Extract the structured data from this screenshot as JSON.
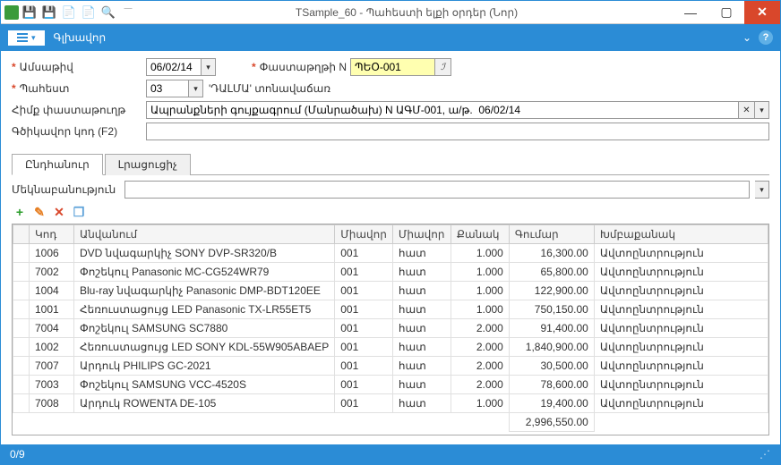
{
  "title": "TSample_60 - Պահեստի ելքի օրդեր (Նոր)",
  "ribbon": {
    "mainLabel": "Գլխավոր"
  },
  "form": {
    "dateLabel": "Ամսաթիվ",
    "dateValue": "06/02/14",
    "docNoLabel": "Փաստաթղթի N",
    "docNoValue": "ՊԵՕ-001",
    "whLabel": "Պահեստ",
    "whCode": "03",
    "whName": "'ԴԱԼՄԱ' տոնավաճառ",
    "baseLabel": "Հիմք փաստաթուղթ",
    "baseValue": "Ապրանքների գույքագրում (Մանրածախ) N ԱԳՄ-001, ա/թ.  06/02/14",
    "f2Label": "Գծիկավոր կոդ (F2)"
  },
  "tabs": {
    "t1": "Ընդհանուր",
    "t2": "Լրացուցիչ"
  },
  "commentLabel": "Մեկնաբանություն",
  "cols": {
    "c1": "Կոդ",
    "c2": "Անվանում",
    "c3": "Միավոր",
    "c4": "Միավոր",
    "c5": "Քանակ",
    "c6": "Գումար",
    "c7": "Խմբաքանակ"
  },
  "rows": [
    {
      "code": "1006",
      "name": "DVD նվագարկիչ SONY DVP-SR320/B",
      "u1": "001",
      "u2": "հատ",
      "qty": "1.000",
      "amt": "16,300.00",
      "batch": "Ավտոընտրություն"
    },
    {
      "code": "7002",
      "name": "Փոշեկուլ Panasonic MC-CG524WR79",
      "u1": "001",
      "u2": "հատ",
      "qty": "1.000",
      "amt": "65,800.00",
      "batch": "Ավտոընտրություն"
    },
    {
      "code": "1004",
      "name": "Blu-ray նվագարկիչ Panasonic DMP-BDT120EE",
      "u1": "001",
      "u2": "հատ",
      "qty": "1.000",
      "amt": "122,900.00",
      "batch": "Ավտոընտրություն"
    },
    {
      "code": "1001",
      "name": "Հեռուստացույց LED Panasonic TX-LR55ET5",
      "u1": "001",
      "u2": "հատ",
      "qty": "1.000",
      "amt": "750,150.00",
      "batch": "Ավտոընտրություն"
    },
    {
      "code": "7004",
      "name": "Փոշեկուլ SAMSUNG SC7880",
      "u1": "001",
      "u2": "հատ",
      "qty": "2.000",
      "amt": "91,400.00",
      "batch": "Ավտոընտրություն"
    },
    {
      "code": "1002",
      "name": "Հեռուստացույց LED SONY KDL-55W905ABAEP",
      "u1": "001",
      "u2": "հատ",
      "qty": "2.000",
      "amt": "1,840,900.00",
      "batch": "Ավտոընտրություն"
    },
    {
      "code": "7007",
      "name": "Արդուկ PHILIPS GC-2021",
      "u1": "001",
      "u2": "հատ",
      "qty": "2.000",
      "amt": "30,500.00",
      "batch": "Ավտոընտրություն"
    },
    {
      "code": "7003",
      "name": "Փոշեկուլ SAMSUNG VCC-4520S",
      "u1": "001",
      "u2": "հատ",
      "qty": "2.000",
      "amt": "78,600.00",
      "batch": "Ավտոընտրություն"
    },
    {
      "code": "7008",
      "name": "Արդուկ ROWENTA DE-105",
      "u1": "001",
      "u2": "հատ",
      "qty": "1.000",
      "amt": "19,400.00",
      "batch": "Ավտոընտրություն"
    }
  ],
  "total": "2,996,550.00",
  "status": "0/9"
}
